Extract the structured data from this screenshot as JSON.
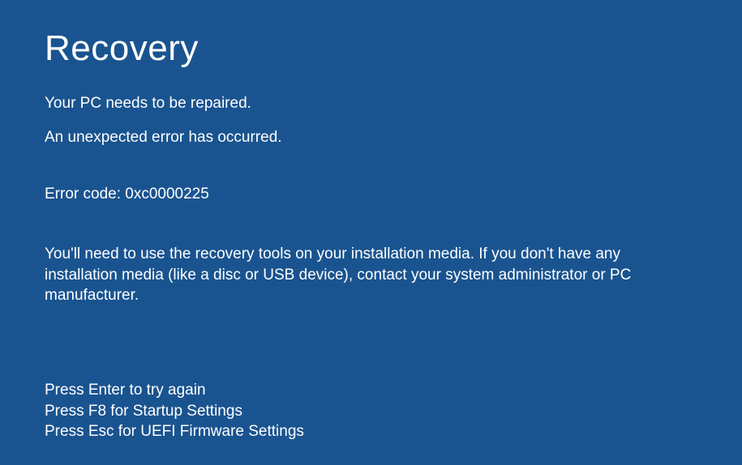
{
  "title": "Recovery",
  "messages": {
    "primary": "Your PC needs to be repaired.",
    "secondary": "An unexpected error has occurred."
  },
  "error": {
    "label": "Error code:",
    "code": "0xc0000225"
  },
  "instructions": "You'll need to use the recovery tools on your installation media. If you don't have any installation media (like a disc or USB device), contact your system administrator or PC manufacturer.",
  "key_options": [
    "Press Enter to try again",
    "Press F8 for Startup Settings",
    "Press Esc for UEFI Firmware Settings"
  ]
}
